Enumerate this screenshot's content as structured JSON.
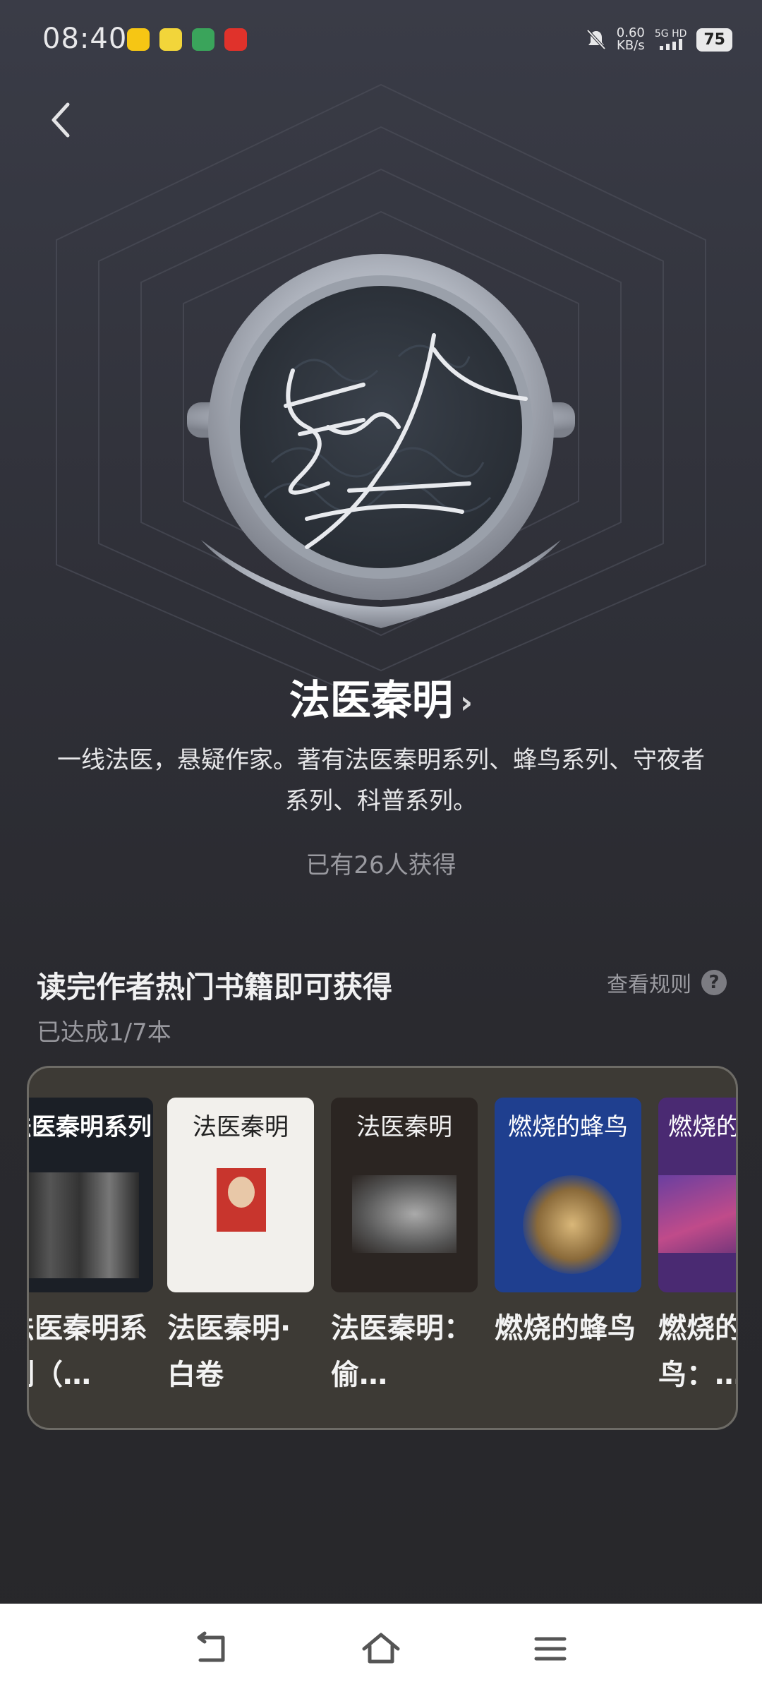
{
  "status_bar": {
    "time": "08:40",
    "speed_value": "0.60",
    "speed_unit": "KB/s",
    "network": "5G HD",
    "battery": "75"
  },
  "badge": {
    "name": "法医秦明",
    "chevron": "›",
    "description": "一线法医，悬疑作家。著有法医秦明系列、蜂鸟系列、守夜者系列、科普系列。",
    "owned_text": "已有26人获得"
  },
  "section": {
    "title": "读完作者热门书籍即可获得",
    "rules_label": "查看规则",
    "help_icon": "?",
    "progress": "已达成1/7本"
  },
  "books": [
    {
      "title": "法医秦明系列（…",
      "cover_text": "法医秦明系列",
      "cover_color": "#1b1f26",
      "cover_text_color": "#ffffff"
    },
    {
      "title": "法医秦明·白卷",
      "cover_text": "法医秦明",
      "cover_color": "#f2f0ec",
      "cover_text_color": "#222222"
    },
    {
      "title": "法医秦明：偷…",
      "cover_text": "法医秦明",
      "cover_color": "#2b2522",
      "cover_text_color": "#f2f2f2"
    },
    {
      "title": "燃烧的蜂鸟",
      "cover_text": "燃烧的蜂鸟",
      "cover_color": "#1f3f8f",
      "cover_text_color": "#ffffff"
    },
    {
      "title": "燃烧的蜂鸟：…",
      "cover_text": "燃烧的",
      "cover_color": "#4a2a72",
      "cover_text_color": "#ffffff"
    }
  ]
}
